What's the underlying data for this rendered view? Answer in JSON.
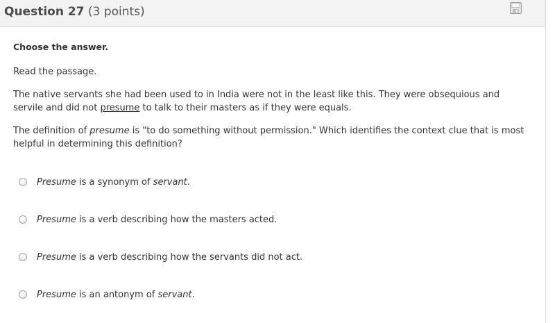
{
  "header": {
    "question_label": "Question 27",
    "points": "(3 points)",
    "icon": "save-icon"
  },
  "content": {
    "instruction": "Choose the answer.",
    "read_prompt": "Read the passage.",
    "passage": {
      "before": "The native servants she had been used to in India were not in the least like this. They were obsequious and servile and did not ",
      "underlined": "presume",
      "after": " to talk to their masters as if they were equals."
    },
    "question": {
      "before": "The definition of ",
      "italic": "presume",
      "after": " is \"to do something without permission.\" Which identifies the context clue that is most helpful in determining this definition?"
    }
  },
  "options": [
    {
      "italic_lead": "Presume",
      "middle": " is a synonym of ",
      "italic_tail": "servant",
      "end": "."
    },
    {
      "italic_lead": "Presume",
      "middle": " is a verb describing how the masters acted.",
      "italic_tail": "",
      "end": ""
    },
    {
      "italic_lead": "Presume",
      "middle": " is a verb describing how the servants did not act.",
      "italic_tail": "",
      "end": ""
    },
    {
      "italic_lead": "Presume",
      "middle": " is an antonym of ",
      "italic_tail": "servant",
      "end": "."
    }
  ]
}
